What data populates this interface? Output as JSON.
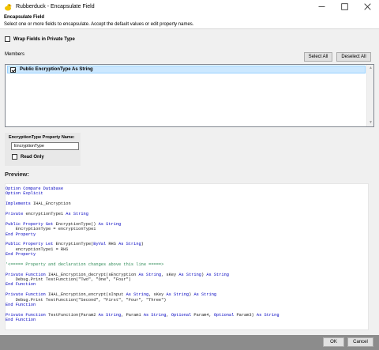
{
  "window": {
    "title": "Rubberduck - Encapsulate Field",
    "minimize": "—",
    "maximize": "☐",
    "close": "✕"
  },
  "header": {
    "title": "Encapsulate Field",
    "description": "Select one or more fields to encapsulate.  Accept the default values or edit property names."
  },
  "options": {
    "wrap_fields_label": "Wrap Fields in Private Type",
    "wrap_fields_checked": false
  },
  "members": {
    "label": "Members",
    "select_all": "Select All",
    "deselect_all": "Deselect All",
    "items": [
      {
        "label": "Public EncryptionType As String",
        "checked": true
      }
    ]
  },
  "property": {
    "label": "EncryptionType Property Name:",
    "value": "EncryptionType",
    "read_only_label": "Read Only",
    "read_only_checked": false
  },
  "preview": {
    "label": "Preview:",
    "lines": [
      [
        {
          "t": "Option Compare Database",
          "c": "kw"
        }
      ],
      [
        {
          "t": "Option Explicit",
          "c": "kw"
        }
      ],
      [],
      [
        {
          "t": "Implements ",
          "c": "kw"
        },
        {
          "t": "IHAL_Encryption",
          "c": "id"
        }
      ],
      [],
      [
        {
          "t": "Private ",
          "c": "kw"
        },
        {
          "t": "encryptionType1 ",
          "c": "id"
        },
        {
          "t": "As String",
          "c": "kw"
        }
      ],
      [],
      [
        {
          "t": "Public Property Get ",
          "c": "kw"
        },
        {
          "t": "EncryptionType() ",
          "c": "id"
        },
        {
          "t": "As String",
          "c": "kw"
        }
      ],
      [
        {
          "t": "    EncryptionType = encryptionType1",
          "c": "id"
        }
      ],
      [
        {
          "t": "End Property",
          "c": "kw"
        }
      ],
      [],
      [
        {
          "t": "Public Property Let ",
          "c": "kw"
        },
        {
          "t": "EncryptionType(",
          "c": "id"
        },
        {
          "t": "ByVal ",
          "c": "kw"
        },
        {
          "t": "RHS ",
          "c": "id"
        },
        {
          "t": "As String",
          "c": "kw"
        },
        {
          "t": ")",
          "c": "id"
        }
      ],
      [
        {
          "t": "    encryptionType1 = RHS",
          "c": "id"
        }
      ],
      [
        {
          "t": "End Property",
          "c": "kw"
        }
      ],
      [],
      [
        {
          "t": "'<===== Property and declaration changes above this line =====>",
          "c": "cm"
        }
      ],
      [],
      [
        {
          "t": "Private Function ",
          "c": "kw"
        },
        {
          "t": "IHAL_Encryption_decrypt(sEncryption ",
          "c": "id"
        },
        {
          "t": "As String",
          "c": "kw"
        },
        {
          "t": ", sKey ",
          "c": "id"
        },
        {
          "t": "As String",
          "c": "kw"
        },
        {
          "t": ") ",
          "c": "id"
        },
        {
          "t": "As String",
          "c": "kw"
        }
      ],
      [
        {
          "t": "    Debug.Print TestFunction(\"Two\", \"One\", \"Four\")",
          "c": "id"
        }
      ],
      [
        {
          "t": "End Function",
          "c": "kw"
        }
      ],
      [],
      [
        {
          "t": "Private Function ",
          "c": "kw"
        },
        {
          "t": "IHAL_Encryption_encrypt(sInput ",
          "c": "id"
        },
        {
          "t": "As String",
          "c": "kw"
        },
        {
          "t": ", sKey ",
          "c": "id"
        },
        {
          "t": "As String",
          "c": "kw"
        },
        {
          "t": ") ",
          "c": "id"
        },
        {
          "t": "As String",
          "c": "kw"
        }
      ],
      [
        {
          "t": "    Debug.Print TestFunction(\"Second\", \"First\", \"Four\", \"Three\")",
          "c": "id"
        }
      ],
      [
        {
          "t": "End Function",
          "c": "kw"
        }
      ],
      [],
      [
        {
          "t": "Private Function ",
          "c": "kw"
        },
        {
          "t": "TestFunction(Param2 ",
          "c": "id"
        },
        {
          "t": "As String",
          "c": "kw"
        },
        {
          "t": ", Param1 ",
          "c": "id"
        },
        {
          "t": "As String",
          "c": "kw"
        },
        {
          "t": ", ",
          "c": "id"
        },
        {
          "t": "Optional ",
          "c": "kw"
        },
        {
          "t": "Param4, ",
          "c": "id"
        },
        {
          "t": "Optional ",
          "c": "kw"
        },
        {
          "t": "Param3) ",
          "c": "id"
        },
        {
          "t": "As String",
          "c": "kw"
        }
      ],
      [
        {
          "t": "End Function",
          "c": "kw"
        }
      ]
    ]
  },
  "footer": {
    "ok": "OK",
    "cancel": "Cancel"
  },
  "colors": {
    "keyword": "#0000c0",
    "identifier": "#1a1a1a",
    "comment": "#2e8b57",
    "selection": "#cce8ff",
    "footer_bar": "#8c8c8c"
  }
}
